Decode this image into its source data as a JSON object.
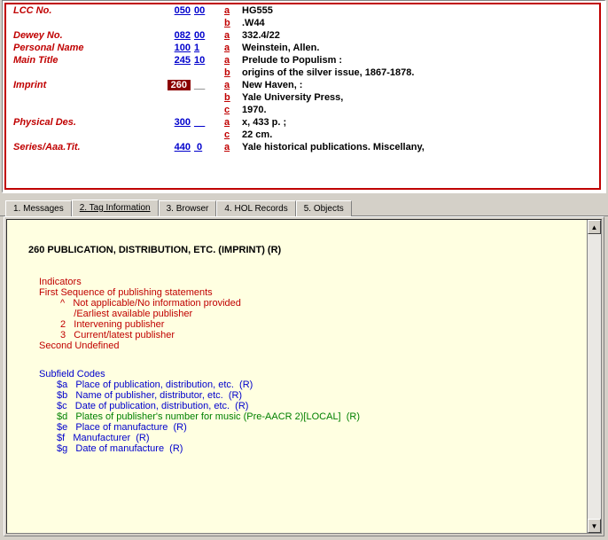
{
  "record": [
    {
      "label": "LCC No.",
      "tag": "050",
      "ind": "00",
      "tagSel": false,
      "subs": [
        {
          "code": "a",
          "val": "HG555"
        },
        {
          "code": "b",
          "val": ".W44"
        }
      ]
    },
    {
      "label": "Dewey No.",
      "tag": "082",
      "ind": "00",
      "tagSel": false,
      "subs": [
        {
          "code": "a",
          "val": "332.4/22"
        }
      ]
    },
    {
      "label": "Personal Name",
      "tag": "100",
      "ind": "1",
      "tagSel": false,
      "subs": [
        {
          "code": "a",
          "val": "Weinstein, Allen."
        }
      ]
    },
    {
      "label": "Main Title",
      "tag": "245",
      "ind": "10",
      "tagSel": false,
      "subs": [
        {
          "code": "a",
          "val": "Prelude to Populism :"
        },
        {
          "code": "b",
          "val": "origins of the silver issue, 1867-1878."
        }
      ]
    },
    {
      "label": "Imprint",
      "tag": "260",
      "ind": "__",
      "tagSel": true,
      "subs": [
        {
          "code": "a",
          "val": "New Haven, :"
        },
        {
          "code": "b",
          "val": "Yale University Press,"
        },
        {
          "code": "c",
          "val": "1970."
        }
      ]
    },
    {
      "label": "Physical Des.",
      "tag": "300",
      "ind": "__",
      "tagSel": false,
      "subs": [
        {
          "code": "a",
          "val": "x, 433 p. ;"
        },
        {
          "code": "c",
          "val": "22 cm."
        }
      ]
    },
    {
      "label": "Series/Aaa.Tit.",
      "tag": "440",
      "ind": " 0",
      "tagSel": false,
      "subs": [
        {
          "code": "a",
          "val": "Yale historical publications. Miscellany,"
        }
      ]
    }
  ],
  "tabs": [
    {
      "label": "1. Messages",
      "active": false
    },
    {
      "label": "2. Tag Information",
      "active": true
    },
    {
      "label": "3. Browser",
      "active": false
    },
    {
      "label": "4. HOL Records",
      "active": false
    },
    {
      "label": "5. Objects",
      "active": false
    }
  ],
  "tagInfo": {
    "heading": "260   PUBLICATION, DISTRIBUTION, ETC. (IMPRINT)  (R)",
    "indicatorsTitle": "Indicators",
    "firstTitle": "First   Sequence of publishing statements",
    "firstItems": [
      {
        "code": "^",
        "text": "Not applicable/No information provided"
      },
      {
        "code": "",
        "text": "/Earliest available publisher"
      },
      {
        "code": "2",
        "text": "Intervening publisher"
      },
      {
        "code": "3",
        "text": "Current/latest publisher"
      }
    ],
    "secondTitle": "Second  Undefined",
    "subfieldTitle": "Subfield Codes",
    "subfields": [
      {
        "code": "$a",
        "text": "Place of publication, distribution, etc.  (R)",
        "cls": "blue"
      },
      {
        "code": "$b",
        "text": "Name of publisher, distributor, etc.  (R)",
        "cls": "blue"
      },
      {
        "code": "$c",
        "text": "Date of publication, distribution, etc.  (R)",
        "cls": "blue"
      },
      {
        "code": "$d",
        "text": "Plates of publisher's number for music (Pre-AACR 2)[LOCAL]  (R)",
        "cls": "green"
      },
      {
        "code": "$e",
        "text": "Place of manufacture  (R)",
        "cls": "blue"
      },
      {
        "code": "$f",
        "text": "Manufacturer  (R)",
        "cls": "blue"
      },
      {
        "code": "$g",
        "text": "Date of manufacture  (R)",
        "cls": "blue"
      }
    ]
  },
  "scroll": {
    "up": "▲",
    "down": "▼"
  }
}
